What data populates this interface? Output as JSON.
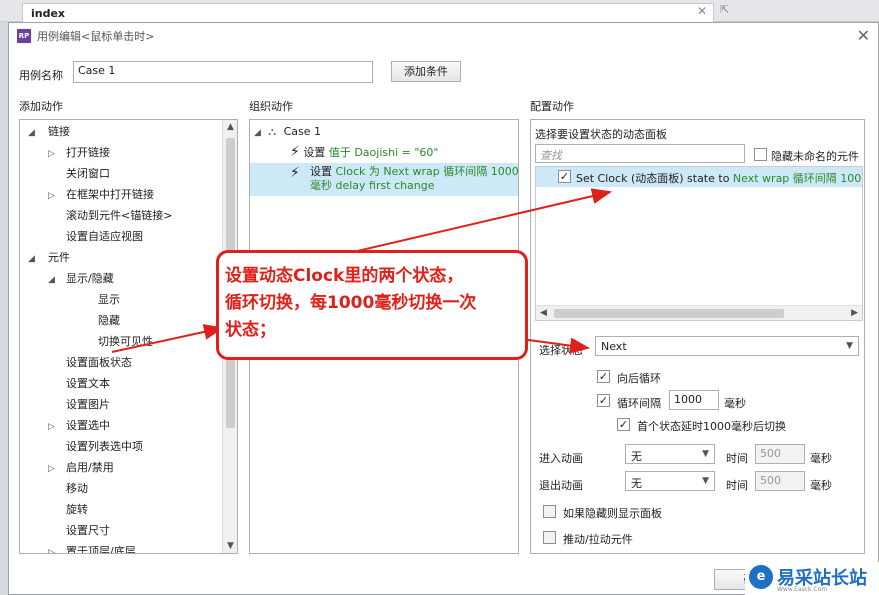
{
  "tab": {
    "label": "index"
  },
  "dialog": {
    "title": "用例编辑<鼠标单击时>",
    "case_name_label": "用例名称",
    "case_name_value": "Case 1",
    "add_condition": "添加条件"
  },
  "sections": {
    "add_action": "添加动作",
    "organize_action": "组织动作",
    "configure_action": "配置动作"
  },
  "action_tree": [
    {
      "label": "链接",
      "level": 0,
      "expander": "open"
    },
    {
      "label": "打开链接",
      "level": 1,
      "expander": "closed"
    },
    {
      "label": "关闭窗口",
      "level": 1,
      "expander": ""
    },
    {
      "label": "在框架中打开链接",
      "level": 1,
      "expander": "closed"
    },
    {
      "label": "滚动到元件<锚链接>",
      "level": 1,
      "expander": ""
    },
    {
      "label": "设置自适应视图",
      "level": 1,
      "expander": ""
    },
    {
      "label": "元件",
      "level": 0,
      "expander": "open"
    },
    {
      "label": "显示/隐藏",
      "level": 1,
      "expander": "open"
    },
    {
      "label": "显示",
      "level": 2,
      "expander": ""
    },
    {
      "label": "隐藏",
      "level": 2,
      "expander": ""
    },
    {
      "label": "切换可见性",
      "level": 2,
      "expander": ""
    },
    {
      "label": "设置面板状态",
      "level": 1,
      "expander": ""
    },
    {
      "label": "设置文本",
      "level": 1,
      "expander": ""
    },
    {
      "label": "设置图片",
      "level": 1,
      "expander": ""
    },
    {
      "label": "设置选中",
      "level": 1,
      "expander": "closed"
    },
    {
      "label": "设置列表选中项",
      "level": 1,
      "expander": ""
    },
    {
      "label": "启用/禁用",
      "level": 1,
      "expander": "closed"
    },
    {
      "label": "移动",
      "level": 1,
      "expander": ""
    },
    {
      "label": "旋转",
      "level": 1,
      "expander": ""
    },
    {
      "label": "设置尺寸",
      "level": 1,
      "expander": ""
    },
    {
      "label": "置于顶层/底层",
      "level": 1,
      "expander": "closed"
    }
  ],
  "organize": {
    "case_label": "Case 1",
    "action1": {
      "prefix": "设置 ",
      "detail": "值于 Daojishi = \"60\""
    },
    "action2": {
      "prefix": "设置 ",
      "detail_line1": "Clock 为 Next wrap 循环间隔 1000",
      "detail_line2": "毫秒 delay first change"
    }
  },
  "configure": {
    "panel_header": "选择要设置状态的动态面板",
    "search_placeholder": "查找",
    "hide_unnamed": "隐藏未命名的元件",
    "item_prefix": "Set Clock (动态面板) state to ",
    "item_detail": "Next wrap 循环间隔 1000 毫秒",
    "select_state_label": "选择状态",
    "select_state_value": "Next",
    "wrap_label": "向后循环",
    "interval_label": "循环间隔",
    "interval_value": "1000",
    "interval_unit": "毫秒",
    "first_delay_label": "首个状态延时1000毫秒后切换",
    "enter_anim_label": "进入动画",
    "enter_anim_value": "无",
    "exit_anim_label": "退出动画",
    "exit_anim_value": "无",
    "time_label": "时间",
    "time_value": "500",
    "time_unit": "毫秒",
    "show_if_hidden": "如果隐藏则显示面板",
    "push_pull": "推动/拉动元件"
  },
  "footer": {
    "ok_partial": "确"
  },
  "callout": {
    "line1": "设置动态Clock里的两个状态，",
    "line2": "循环切换，每1000毫秒切换一次",
    "line3": "状态；"
  },
  "watermark": {
    "text": "易采站长站",
    "sub": "Www.Easck.Com",
    "icon": "e-logo-icon"
  },
  "colors": {
    "callout_red": "#e0201a",
    "detail_green": "#2a8a2a",
    "selection_blue": "#cde8f7"
  }
}
